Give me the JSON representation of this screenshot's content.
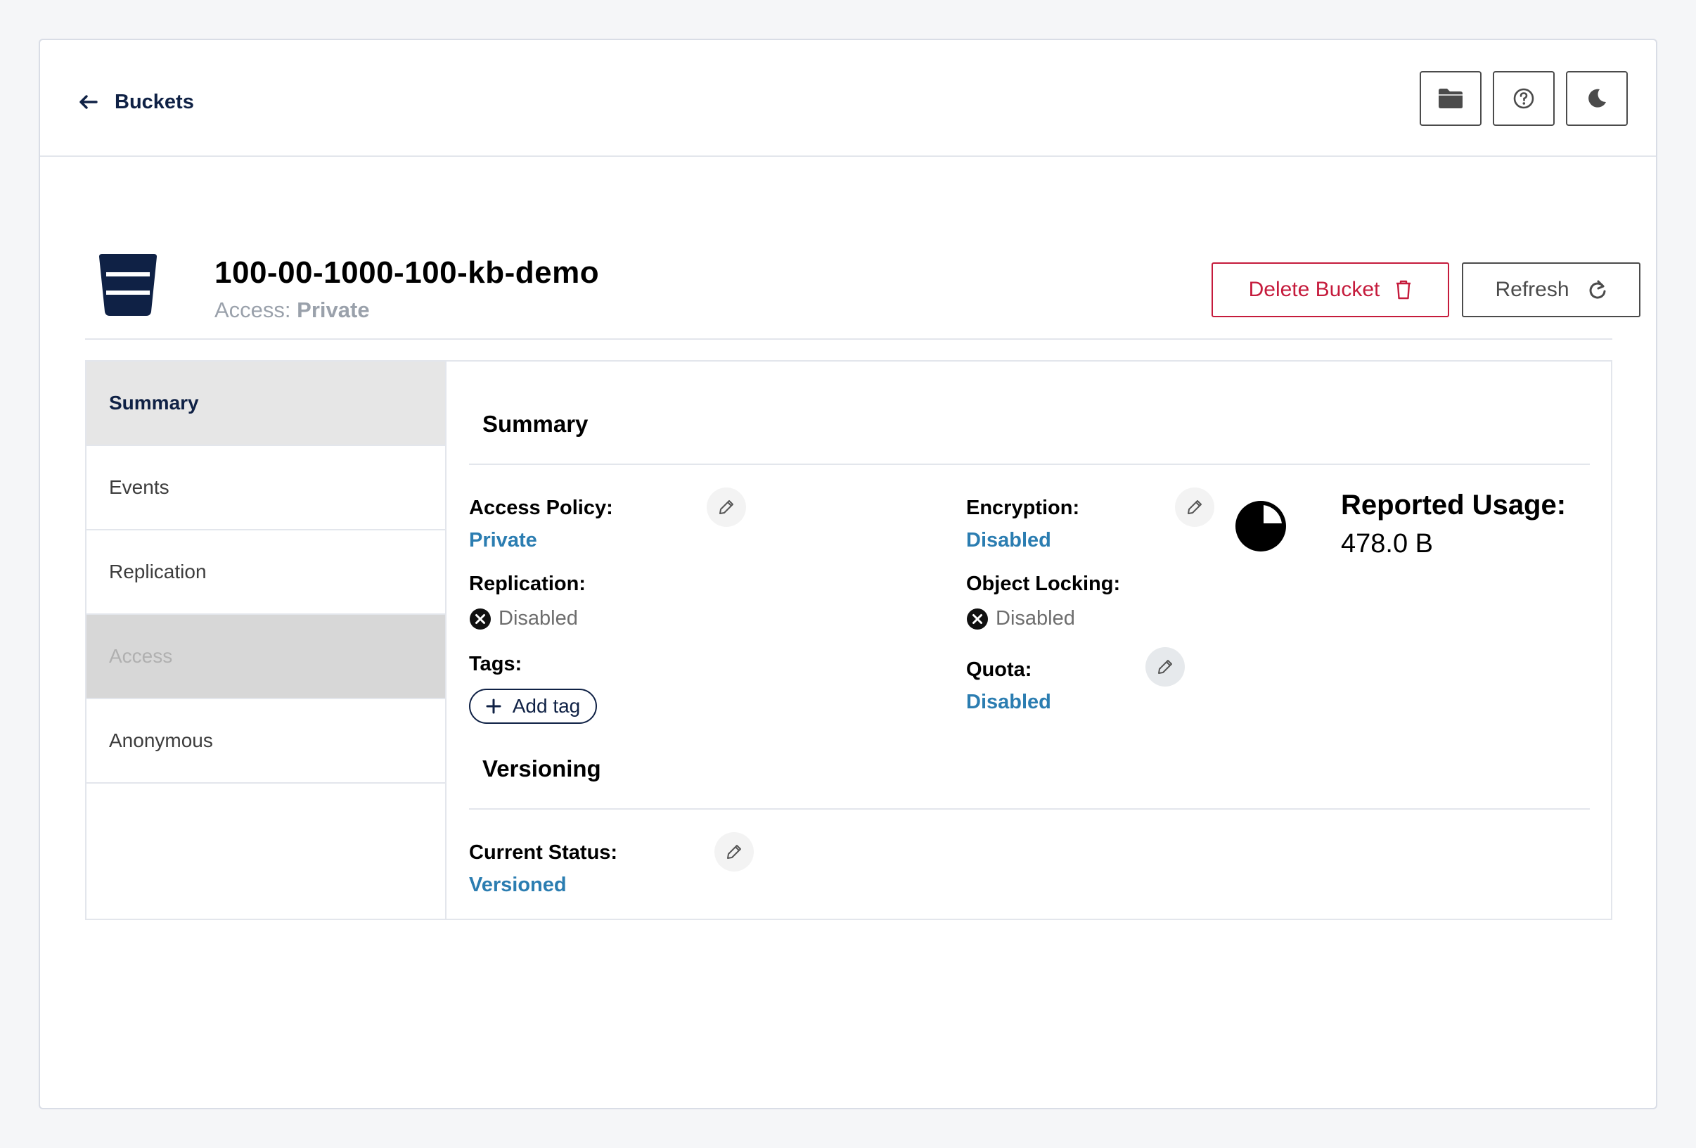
{
  "topbar": {
    "back_label": "Buckets",
    "icons": [
      "folder-icon",
      "help-circle-icon",
      "moon-icon"
    ]
  },
  "bucket": {
    "name": "100-00-1000-100-kb-demo",
    "access_prefix": "Access:",
    "access_value": "Private",
    "delete_label": "Delete Bucket",
    "refresh_label": "Refresh"
  },
  "sidebar": {
    "items": [
      {
        "label": "Summary",
        "state": "active"
      },
      {
        "label": "Events",
        "state": "normal"
      },
      {
        "label": "Replication",
        "state": "normal"
      },
      {
        "label": "Access",
        "state": "disabled"
      },
      {
        "label": "Anonymous",
        "state": "normal"
      }
    ]
  },
  "summary": {
    "title": "Summary",
    "access_policy_label": "Access Policy:",
    "access_policy_value": "Private",
    "replication_label": "Replication:",
    "replication_value": "Disabled",
    "tags_label": "Tags:",
    "add_tag_label": "Add tag",
    "encryption_label": "Encryption:",
    "encryption_value": "Disabled",
    "object_locking_label": "Object Locking:",
    "object_locking_value": "Disabled",
    "quota_label": "Quota:",
    "quota_value": "Disabled",
    "reported_usage_label": "Reported Usage:",
    "reported_usage_value": "478.0 B"
  },
  "versioning": {
    "title": "Versioning",
    "current_status_label": "Current Status:",
    "current_status_value": "Versioned"
  },
  "colors": {
    "link": "#2b7db1",
    "danger": "#c51b3c",
    "navy": "#0f2145"
  }
}
